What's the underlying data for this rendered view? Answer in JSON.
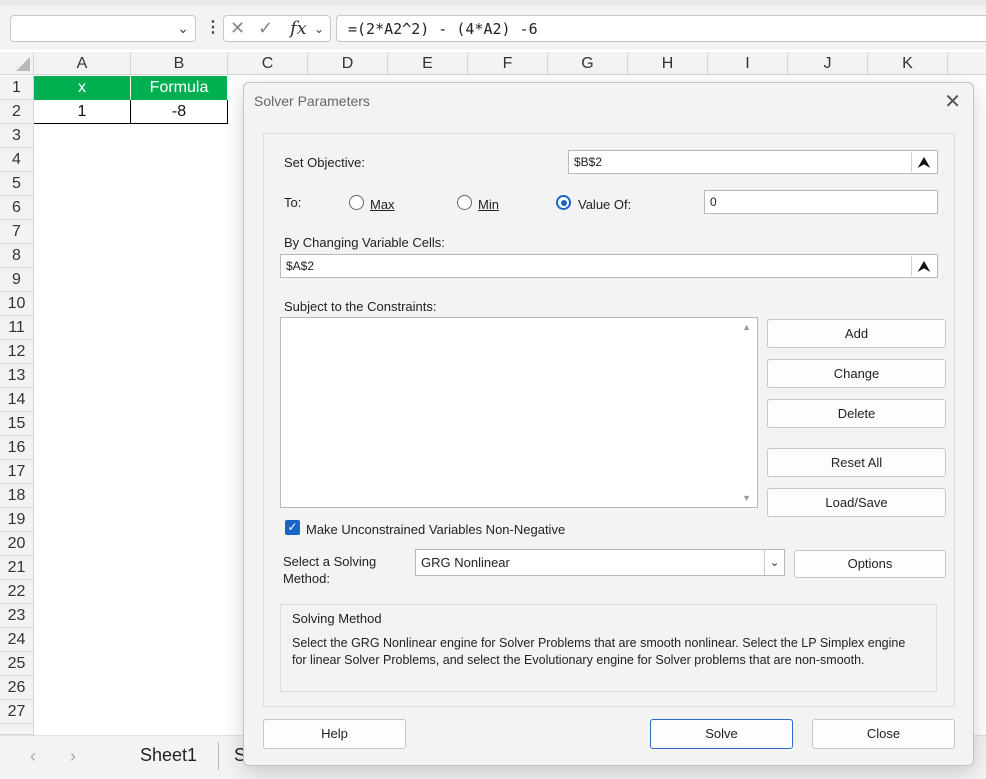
{
  "formula_bar": {
    "name_box": "",
    "cancel_icon": "✕",
    "enter_icon": "✓",
    "fx_label": "fx",
    "formula": "=(2*A2^2) - (4*A2) -6"
  },
  "grid": {
    "columns": [
      "A",
      "B",
      "C",
      "D",
      "E",
      "F",
      "G",
      "H",
      "I",
      "J",
      "K"
    ],
    "rows": [
      "1",
      "2",
      "3",
      "4",
      "5",
      "6",
      "7",
      "8",
      "9",
      "10",
      "11",
      "12",
      "13",
      "14",
      "15",
      "16",
      "17",
      "18",
      "19",
      "20",
      "21",
      "22",
      "23",
      "24",
      "25",
      "26",
      "27"
    ],
    "header_fill": "#00b050",
    "a1": "x",
    "b1": "Formula",
    "a2": "1",
    "b2": "-8"
  },
  "sheet_tabs": {
    "prev": "‹",
    "next": "›",
    "active": "Sheet1",
    "next_sheet_partial": "S"
  },
  "dialog": {
    "title": "Solver Parameters",
    "set_objective_label": "Set Objective:",
    "objective_value": "$B$2",
    "to_label": "To:",
    "max_label": "Max",
    "min_label": "Min",
    "value_of_label": "Value Of:",
    "selected_option": "Value Of",
    "value_of_value": "0",
    "changing_cells_label": "By Changing Variable Cells:",
    "changing_cells_value": "$A$2",
    "constraints_label": "Subject to the Constraints:",
    "buttons": {
      "add": "Add",
      "change": "Change",
      "delete": "Delete",
      "reset_all": "Reset All",
      "load_save": "Load/Save",
      "options": "Options",
      "help": "Help",
      "solve": "Solve",
      "close": "Close"
    },
    "nonneg_label": "Make Unconstrained Variables Non-Negative",
    "nonneg_checked": true,
    "method_label_line1": "Select a Solving",
    "method_label_line2": "Method:",
    "method_value": "GRG Nonlinear",
    "info_title": "Solving Method",
    "info_text": "Select the GRG Nonlinear engine for Solver Problems that are smooth nonlinear. Select the LP Simplex engine for linear Solver Problems, and select the Evolutionary engine for Solver problems that are non-smooth.",
    "accent_color": "#1a64c8"
  }
}
